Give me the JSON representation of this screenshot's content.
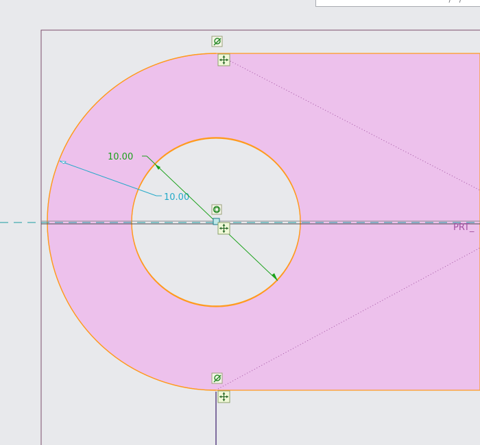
{
  "viewport": {
    "info_text": "' ' ' /  /"
  },
  "sketch": {
    "dimensions": [
      {
        "id": "diameter",
        "value": "10.00",
        "color": "#1aa11a"
      },
      {
        "id": "radius",
        "value": "10.00",
        "color": "#22a9c8"
      }
    ],
    "datum_label": "PRT_",
    "colors": {
      "fill": "#edc1ec",
      "edge": "#ff9a1e",
      "frame": "#7a4a6a",
      "axis": "#1a9aa0",
      "construction": "#a050a0",
      "diameter_dim": "#1aa11a",
      "radius_dim": "#22a9c8"
    },
    "icons": [
      "tangent-constraint-icon",
      "centerpoint-icon",
      "snap-cross-icon"
    ]
  }
}
